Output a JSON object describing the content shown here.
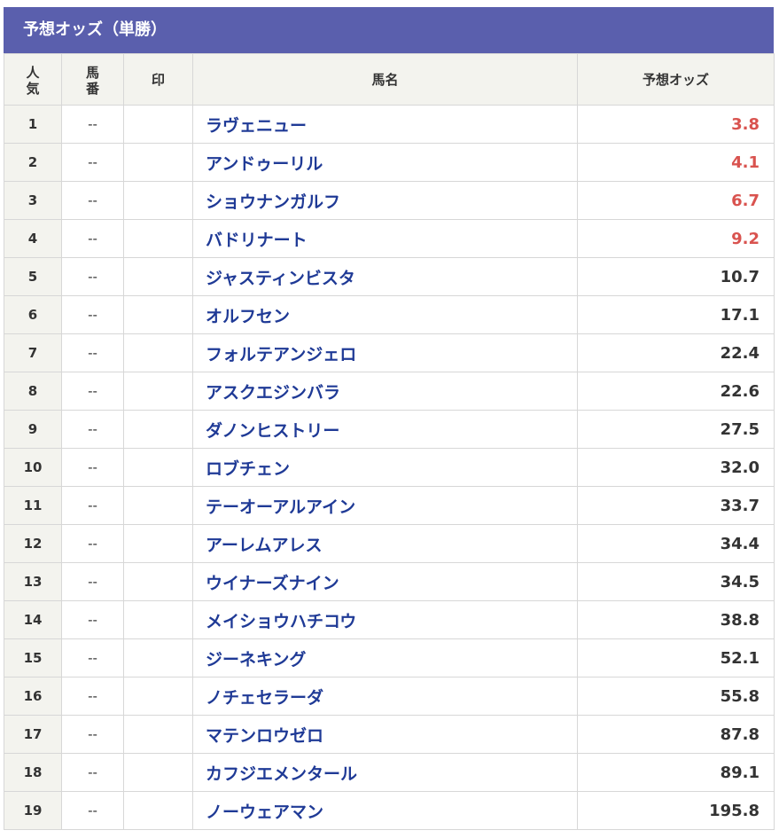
{
  "panel": {
    "title": "予想オッズ（単勝）",
    "headers": {
      "popularity_line1": "人",
      "popularity_line2": "気",
      "number_line1": "馬",
      "number_line2": "番",
      "mark": "印",
      "horse_name": "馬名",
      "odds": "予想オッズ"
    },
    "colors": {
      "header_bg": "#5a5fad",
      "horse_name": "#1f3a96",
      "favorite_odds": "#d9534f"
    },
    "rows": [
      {
        "rank": "1",
        "umaban": "--",
        "mark": "",
        "name": "ラヴェニュー",
        "odds": "3.8",
        "hot": true
      },
      {
        "rank": "2",
        "umaban": "--",
        "mark": "",
        "name": "アンドゥーリル",
        "odds": "4.1",
        "hot": true
      },
      {
        "rank": "3",
        "umaban": "--",
        "mark": "",
        "name": "ショウナンガルフ",
        "odds": "6.7",
        "hot": true
      },
      {
        "rank": "4",
        "umaban": "--",
        "mark": "",
        "name": "バドリナート",
        "odds": "9.2",
        "hot": true
      },
      {
        "rank": "5",
        "umaban": "--",
        "mark": "",
        "name": "ジャスティンビスタ",
        "odds": "10.7",
        "hot": false
      },
      {
        "rank": "6",
        "umaban": "--",
        "mark": "",
        "name": "オルフセン",
        "odds": "17.1",
        "hot": false
      },
      {
        "rank": "7",
        "umaban": "--",
        "mark": "",
        "name": "フォルテアンジェロ",
        "odds": "22.4",
        "hot": false
      },
      {
        "rank": "8",
        "umaban": "--",
        "mark": "",
        "name": "アスクエジンバラ",
        "odds": "22.6",
        "hot": false
      },
      {
        "rank": "9",
        "umaban": "--",
        "mark": "",
        "name": "ダノンヒストリー",
        "odds": "27.5",
        "hot": false
      },
      {
        "rank": "10",
        "umaban": "--",
        "mark": "",
        "name": "ロブチェン",
        "odds": "32.0",
        "hot": false
      },
      {
        "rank": "11",
        "umaban": "--",
        "mark": "",
        "name": "テーオーアルアイン",
        "odds": "33.7",
        "hot": false
      },
      {
        "rank": "12",
        "umaban": "--",
        "mark": "",
        "name": "アーレムアレス",
        "odds": "34.4",
        "hot": false
      },
      {
        "rank": "13",
        "umaban": "--",
        "mark": "",
        "name": "ウイナーズナイン",
        "odds": "34.5",
        "hot": false
      },
      {
        "rank": "14",
        "umaban": "--",
        "mark": "",
        "name": "メイショウハチコウ",
        "odds": "38.8",
        "hot": false
      },
      {
        "rank": "15",
        "umaban": "--",
        "mark": "",
        "name": "ジーネキング",
        "odds": "52.1",
        "hot": false
      },
      {
        "rank": "16",
        "umaban": "--",
        "mark": "",
        "name": "ノチェセラーダ",
        "odds": "55.8",
        "hot": false
      },
      {
        "rank": "17",
        "umaban": "--",
        "mark": "",
        "name": "マテンロウゼロ",
        "odds": "87.8",
        "hot": false
      },
      {
        "rank": "18",
        "umaban": "--",
        "mark": "",
        "name": "カフジエメンタール",
        "odds": "89.1",
        "hot": false
      },
      {
        "rank": "19",
        "umaban": "--",
        "mark": "",
        "name": "ノーウェアマン",
        "odds": "195.8",
        "hot": false
      }
    ]
  }
}
